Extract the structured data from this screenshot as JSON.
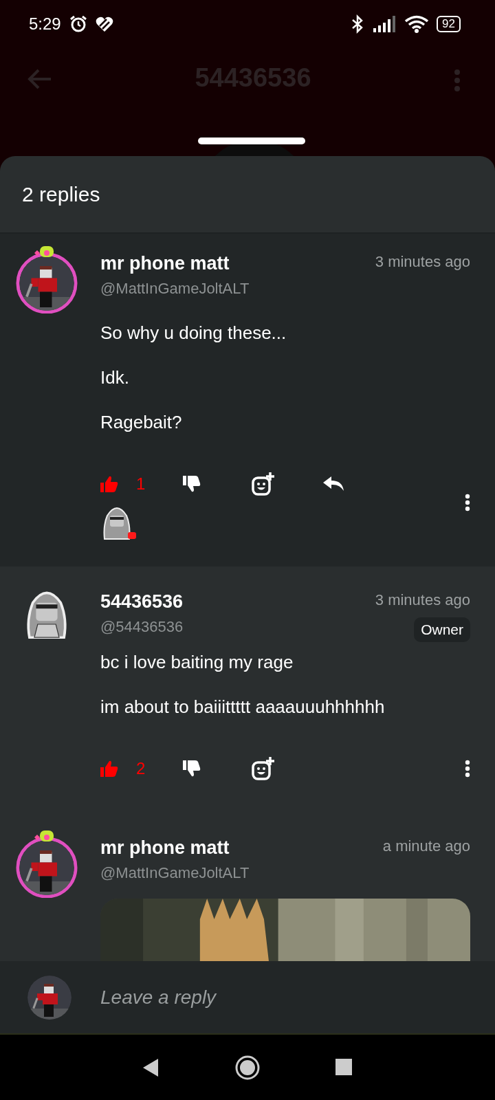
{
  "status_bar": {
    "time": "5:29",
    "battery": "92"
  },
  "page_header": {
    "title": "54436536"
  },
  "sheet": {
    "title": "2 replies"
  },
  "comments": [
    {
      "kind": "parent",
      "name": "mr phone matt",
      "handle": "@MattInGameJoltALT",
      "time": "3 minutes ago",
      "paragraphs": [
        "So why u doing these...",
        "Idk.",
        "Ragebait?"
      ],
      "liked": true,
      "likes": "1"
    },
    {
      "kind": "owner",
      "name": "54436536",
      "handle": "@54436536",
      "time": "3 minutes ago",
      "badge": "Owner",
      "paragraphs": [
        "bc i love baiting my rage",
        "im about to baiiittttt aaaauuuhhhhhh"
      ],
      "liked": true,
      "likes": "2"
    },
    {
      "kind": "reply",
      "name": "mr phone matt",
      "handle": "@MattInGameJoltALT",
      "time": "a minute ago"
    }
  ],
  "reply_bar": {
    "placeholder": "Leave a reply"
  }
}
